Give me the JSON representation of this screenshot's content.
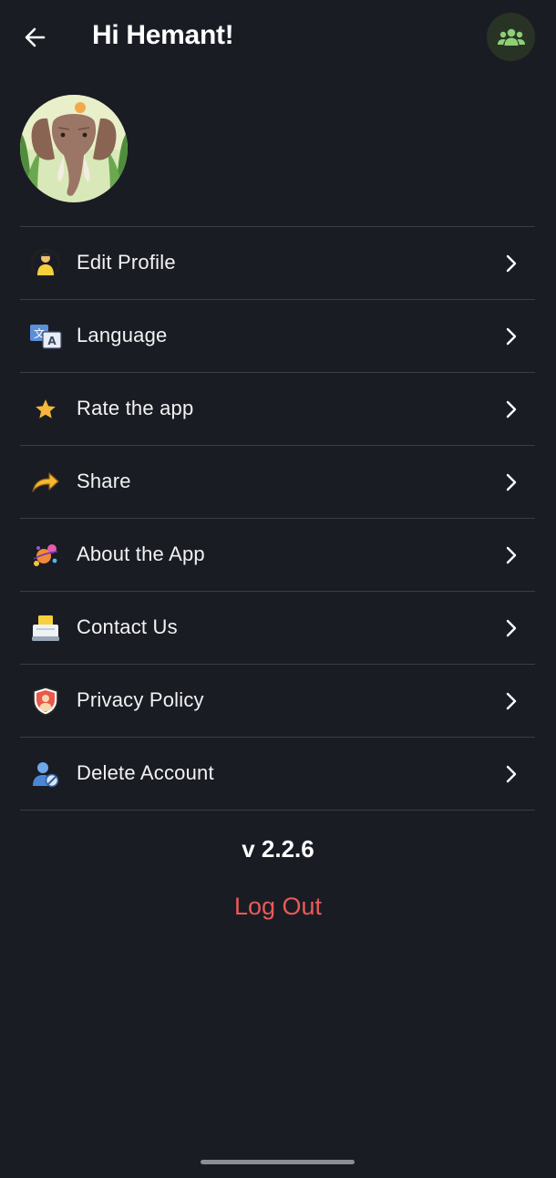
{
  "header": {
    "greeting": "Hi Hemant!",
    "back_icon": "arrow-left-icon",
    "group_icon": "group-icon",
    "group_icon_color": "#8ecf74"
  },
  "profile": {
    "avatar_icon": "elephant-avatar"
  },
  "menu": {
    "items": [
      {
        "label": "Edit Profile",
        "icon": "user-edit-icon"
      },
      {
        "label": "Language",
        "icon": "translate-icon"
      },
      {
        "label": "Rate the app",
        "icon": "star-icon"
      },
      {
        "label": "Share",
        "icon": "share-arrow-icon"
      },
      {
        "label": "About the App",
        "icon": "rocket-icon"
      },
      {
        "label": "Contact Us",
        "icon": "support-icon"
      },
      {
        "label": "Privacy Policy",
        "icon": "shield-user-icon"
      },
      {
        "label": "Delete Account",
        "icon": "user-remove-icon"
      }
    ]
  },
  "footer": {
    "version": "v 2.2.6",
    "logout_label": "Log Out",
    "logout_color": "#ea5a58"
  }
}
